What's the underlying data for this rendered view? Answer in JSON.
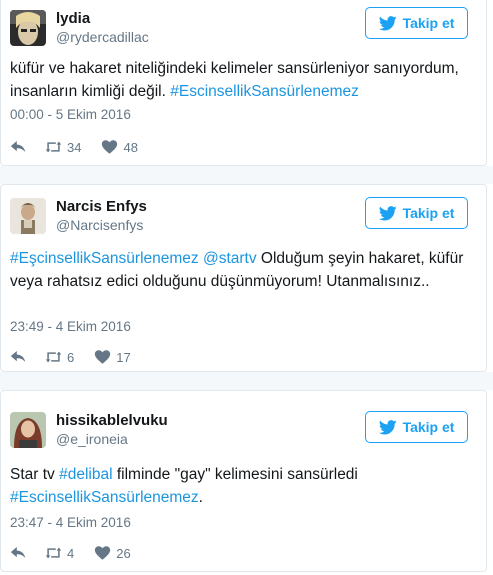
{
  "follow_label": "Takip et",
  "colors": {
    "accent": "#1da1f2",
    "hashtag": "#1b95e0",
    "muted": "#657786"
  },
  "tweets": [
    {
      "name": "lydia",
      "handle": "@rydercadillac",
      "text_before": "küfür ve hakaret niteliğindeki kelimeler sansürleniyor sanıyordum, insanların kimliği değil. ",
      "hashtag": "#EscinsellikSansürlenemez",
      "text_after": "",
      "time": "00:00 - 5 Ekim 2016",
      "retweets": "34",
      "likes": "48"
    },
    {
      "name": "Narcis Enfys",
      "handle": "@Narcisenfys",
      "hashtag": "#EşcinsellikSansürlenemez",
      "mention": "@startv",
      "text_after": " Olduğum şeyin hakaret, küfür veya rahatsız edici olduğunu düşünmüyorum! Utanmalısınız..",
      "time": "23:49 - 4 Ekim 2016",
      "retweets": "6",
      "likes": "17"
    },
    {
      "name": "hissikablelvuku",
      "handle": "@e_ironeia",
      "text_before": "Star tv ",
      "hashtag_inline": "#delibal",
      "text_middle": " filminde \"gay\" kelimesini sansürledi ",
      "hashtag": "#EscinsellikSansürlenemez",
      "text_after": ".",
      "time": "23:47 - 4 Ekim 2016",
      "retweets": "4",
      "likes": "26"
    }
  ]
}
